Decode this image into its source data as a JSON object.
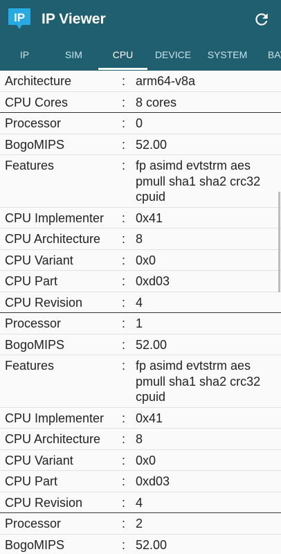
{
  "app": {
    "title": "IP Viewer",
    "logo_text": "IP",
    "refresh_icon": "refresh-icon",
    "colors": {
      "appbar": "#1f5f6f",
      "logo": "#29a9e1",
      "tab_inactive": "#c9e3e9"
    }
  },
  "tabs": [
    {
      "label": "IP",
      "active": false
    },
    {
      "label": "SIM",
      "active": false
    },
    {
      "label": "CPU",
      "active": true
    },
    {
      "label": "DEVICE",
      "active": false
    },
    {
      "label": "SYSTEM",
      "active": false
    },
    {
      "label": "BAT",
      "active": false
    }
  ],
  "rows": [
    {
      "label": "Architecture",
      "value": "arm64-v8a"
    },
    {
      "label": "CPU Cores",
      "value": "8 cores",
      "group_end": true
    },
    {
      "label": "Processor",
      "value": "0"
    },
    {
      "label": "BogoMIPS",
      "value": "52.00"
    },
    {
      "label": "Features",
      "value": "fp asimd evtstrm aes pmull sha1 sha2 crc32 cpuid"
    },
    {
      "label": "CPU Implementer",
      "value": "0x41"
    },
    {
      "label": "CPU Architecture",
      "value": "8"
    },
    {
      "label": "CPU Variant",
      "value": "0x0"
    },
    {
      "label": "CPU Part",
      "value": "0xd03"
    },
    {
      "label": "CPU Revision",
      "value": "4",
      "group_end": true
    },
    {
      "label": "Processor",
      "value": "1"
    },
    {
      "label": "BogoMIPS",
      "value": "52.00"
    },
    {
      "label": "Features",
      "value": "fp asimd evtstrm aes pmull sha1 sha2 crc32 cpuid"
    },
    {
      "label": "CPU Implementer",
      "value": "0x41"
    },
    {
      "label": "CPU Architecture",
      "value": "8"
    },
    {
      "label": "CPU Variant",
      "value": "0x0"
    },
    {
      "label": "CPU Part",
      "value": "0xd03"
    },
    {
      "label": "CPU Revision",
      "value": "4",
      "group_end": true
    },
    {
      "label": "Processor",
      "value": "2"
    },
    {
      "label": "BogoMIPS",
      "value": "52.00"
    }
  ],
  "separator": ":"
}
